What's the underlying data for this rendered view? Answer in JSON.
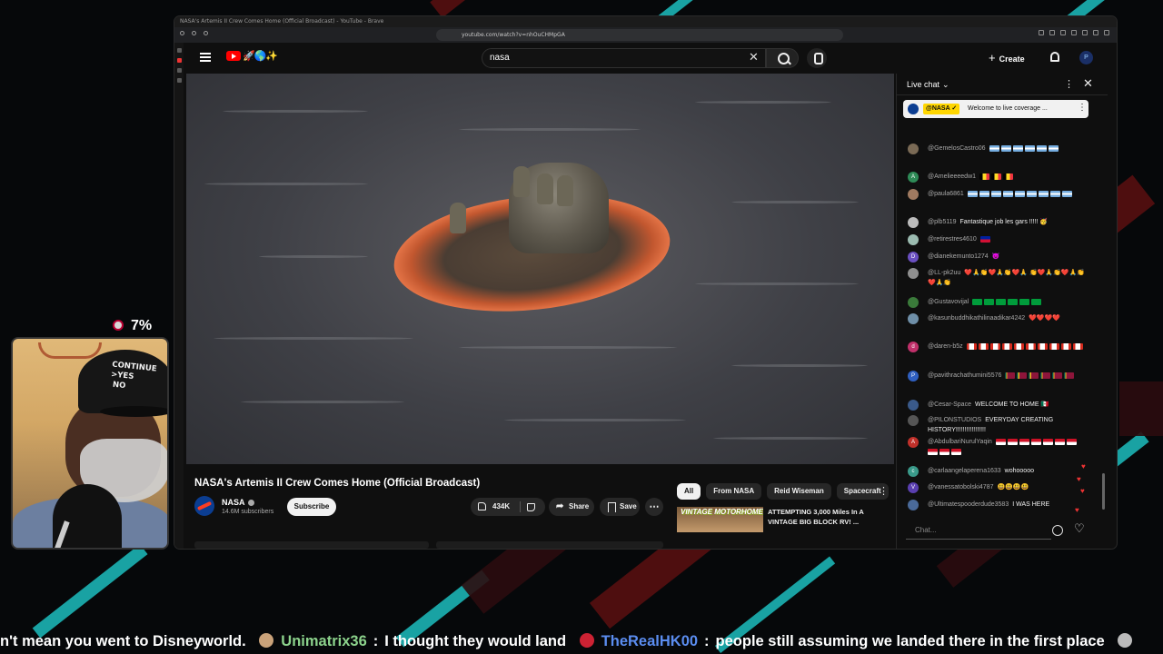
{
  "browser": {
    "tab_title": "NASA's Artemis II Crew Comes Home (Official Broadcast) - YouTube - Brave",
    "url": "youtube.com/watch?v=nhOuCHMpGA"
  },
  "header": {
    "search_value": "nasa",
    "create_label": "Create",
    "avatar_initial": "P",
    "doodle": "🚀🌎✨"
  },
  "video": {
    "title": "NASA's Artemis II Crew Comes Home (Official Broadcast)",
    "channel": "NASA",
    "subscribers": "14.6M subscribers",
    "subscribe_label": "Subscribe",
    "likes": "434K",
    "share_label": "Share",
    "save_label": "Save",
    "more": "⋯"
  },
  "recommendations": {
    "chips": [
      "All",
      "From NASA",
      "Reid Wiseman",
      "Spacecraft"
    ],
    "active_chip": "All",
    "items": [
      {
        "thumb_text": "VINTAGE MOTORHOME",
        "title": "ATTEMPTING 3,000 Miles In A VINTAGE BIG BLOCK RV! ..."
      }
    ]
  },
  "chat": {
    "title": "Live chat",
    "pinned": {
      "author": "@NASA ✓",
      "text": "Welcome to live coverage ..."
    },
    "messages": [
      {
        "author": "@GemelosCastro06",
        "text": "",
        "flags": "ar6",
        "avatar": "",
        "avatar_color": "#7a6a55"
      },
      {
        "author": "@Amelieeeedw1",
        "text": "",
        "flags": "be3",
        "avatar": "A",
        "avatar_color": "#2e8b57"
      },
      {
        "author": "@paula6861",
        "text": "",
        "flags": "ar9",
        "avatar": "",
        "avatar_color": "#a07a60"
      },
      {
        "author": "@plb5119",
        "text": "Fantastique job les gars !!!!! 🥳",
        "flags": "",
        "avatar": "",
        "avatar_color": "#bbbbbb"
      },
      {
        "author": "@retirestres4610",
        "text": "",
        "flags": "ht1",
        "avatar": "",
        "avatar_color": "#9bbbb0"
      },
      {
        "author": "@dianekemunto1274",
        "text": "😈",
        "flags": "",
        "avatar": "D",
        "avatar_color": "#6a4fc0"
      },
      {
        "author": "@LL-pk2uu",
        "text": "❤️🙏👏❤️🙏👏❤️🙏 👏❤️🙏👏❤️🙏👏❤️🙏👏",
        "flags": "",
        "avatar": "",
        "avatar_color": "#8f8f8f"
      },
      {
        "author": "@Gustavovijal",
        "text": "",
        "flags": "br6",
        "avatar": "",
        "avatar_color": "#3a7a3a"
      },
      {
        "author": "@kasunbuddhikathilinaadikar4242",
        "text": "❤️❤️❤️❤️",
        "flags": "",
        "avatar": "",
        "avatar_color": "#6f8fa8"
      },
      {
        "author": "@daren-b5z",
        "text": "",
        "flags": "ca10",
        "avatar": "d",
        "avatar_color": "#c0306a"
      },
      {
        "author": "@pavithrachathumini5576",
        "text": "",
        "flags": "lk6",
        "avatar": "P",
        "avatar_color": "#2f5fc0"
      },
      {
        "author": "@Cesar-Space",
        "text": "WELCOME TO HOME 🇲🇽",
        "flags": "",
        "avatar": "",
        "avatar_color": "#3a5a8a"
      },
      {
        "author": "@PILONSTUDIOS",
        "text": "EVERYDAY CREATING HISTORY!!!!!!!!!!!!!!!!!",
        "flags": "",
        "avatar": "",
        "avatar_color": "#555555"
      },
      {
        "author": "@AbdulbariNurulYaqin",
        "text": "",
        "flags": "id10",
        "avatar": "A",
        "avatar_color": "#c0302a"
      },
      {
        "author": "@carlaangelaperena1633",
        "text": "wohooooo",
        "flags": "",
        "avatar": "c",
        "avatar_color": "#3a9a8a"
      },
      {
        "author": "@vanessatobolski4787",
        "text": "😃😃😃😃",
        "flags": "",
        "avatar": "V",
        "avatar_color": "#5a3fb0"
      },
      {
        "author": "@Ultimatespooderdude3583",
        "text": "I WAS HERE",
        "flags": "",
        "avatar": "",
        "avatar_color": "#4a6a9a"
      }
    ],
    "input_placeholder": "Chat..."
  },
  "overlay": {
    "percent": "7%",
    "cap_text": "CONTINUE\n>YES\n NO",
    "ticker": [
      {
        "user": "",
        "message": "n't mean you went to Disneyworld."
      },
      {
        "user": "Unimatrix36",
        "message": "I thought they would land"
      },
      {
        "user": "TheRealHK00",
        "message": "people still assuming we landed there in the first place"
      }
    ]
  },
  "colors": {
    "yt_red": "#ff0000",
    "accent_cyan": "#1ec9c9",
    "stripe_red": "#8a1414",
    "chip_active_bg": "#f1f1f1",
    "pinned_author_bg": "#ffd600"
  }
}
